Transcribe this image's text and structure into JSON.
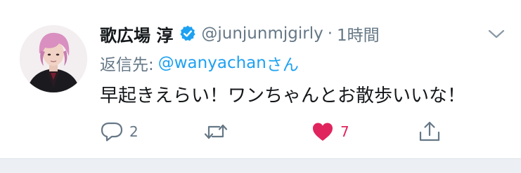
{
  "tweet": {
    "display_name": "歌広場 淳",
    "handle": "@junjunmjgirly",
    "separator": "·",
    "time": "1時間",
    "reply_label": "返信先:",
    "reply_handle": "@wanyachan",
    "reply_suffix": "さん",
    "text": "早起きえらい！ワンちゃんとお散歩いいな！",
    "verified": true
  },
  "actions": {
    "reply": {
      "icon": "reply-icon",
      "count": "2"
    },
    "retweet": {
      "icon": "retweet-icon",
      "count": ""
    },
    "like": {
      "icon": "heart-icon",
      "count": "7",
      "liked": true
    },
    "share": {
      "icon": "share-icon",
      "count": ""
    }
  },
  "colors": {
    "link": "#1da1f2",
    "secondary_text": "#657786",
    "primary_text": "#14171a",
    "like": "#e0245e",
    "verified": "#1da1f2"
  },
  "icons": [
    "avatar",
    "verified-badge-icon",
    "chevron-down-icon",
    "reply-icon",
    "retweet-icon",
    "heart-icon",
    "share-icon"
  ]
}
